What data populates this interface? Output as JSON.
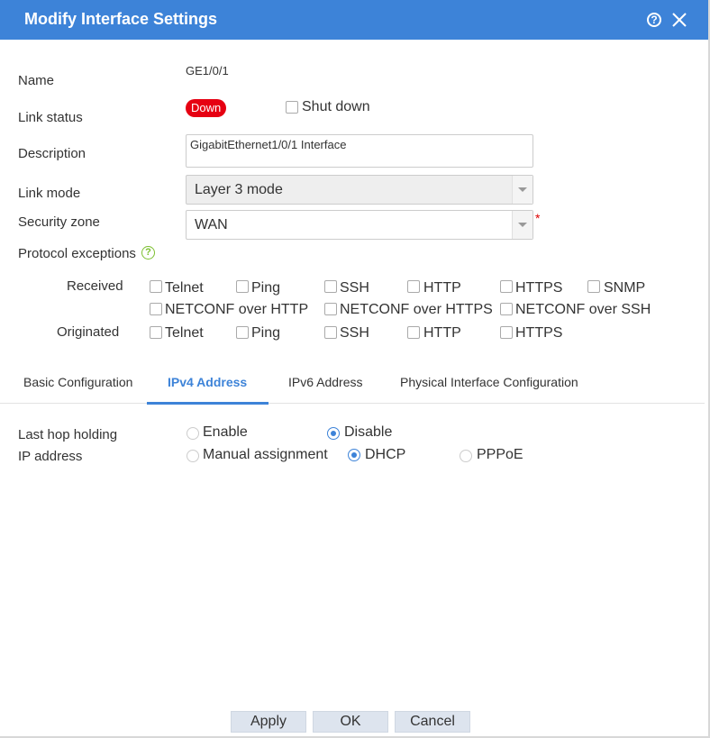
{
  "dialog": {
    "title": "Modify Interface Settings",
    "help_icon": "question-circle-icon",
    "close_icon": "close-icon"
  },
  "form": {
    "name_label": "Name",
    "name_value": "GE1/0/1",
    "link_status_label": "Link status",
    "link_status_value": "Down",
    "shutdown_label": "Shut down",
    "description_label": "Description",
    "description_value": "GigabitEthernet1/0/1 Interface",
    "link_mode_label": "Link mode",
    "link_mode_value": "Layer 3 mode",
    "security_zone_label": "Security zone",
    "security_zone_value": "WAN",
    "required_mark": "*",
    "protocol_exceptions_label": "Protocol exceptions"
  },
  "protocols": {
    "received_label": "Received",
    "received": [
      "Telnet",
      "Ping",
      "SSH",
      "HTTP",
      "HTTPS",
      "SNMP",
      "NETCONF over HTTP",
      "NETCONF over HTTPS",
      "NETCONF over SSH"
    ],
    "originated_label": "Originated",
    "originated": [
      "Telnet",
      "Ping",
      "SSH",
      "HTTP",
      "HTTPS"
    ]
  },
  "tabs": [
    "Basic Configuration",
    "IPv4 Address",
    "IPv6 Address",
    "Physical Interface Configuration"
  ],
  "active_tab": "IPv4 Address",
  "ipv4": {
    "last_hop_label": "Last hop holding",
    "enable_label": "Enable",
    "disable_label": "Disable",
    "last_hop_selected": "Disable",
    "ip_address_label": "IP address",
    "manual_label": "Manual assignment",
    "dhcp_label": "DHCP",
    "pppoe_label": "PPPoE",
    "ip_selected": "DHCP"
  },
  "buttons": {
    "apply": "Apply",
    "ok": "OK",
    "cancel": "Cancel"
  },
  "colors": {
    "accent": "#3d83d8",
    "status_down": "#e60012",
    "help_green": "#7cbf30",
    "required": "#dd0000"
  }
}
